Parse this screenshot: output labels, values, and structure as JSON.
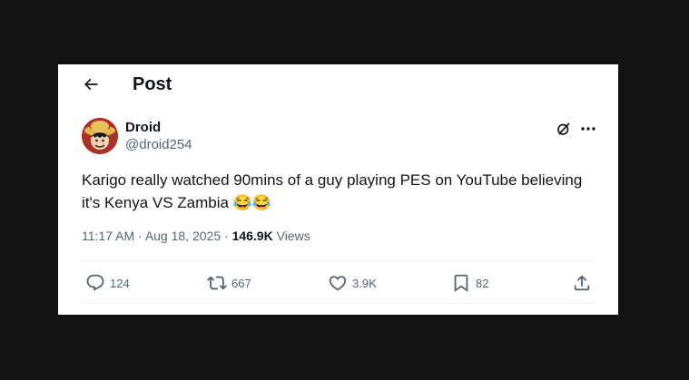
{
  "header": {
    "title": "Post",
    "back_icon": "arrow-left-icon"
  },
  "post": {
    "author_name": "Droid",
    "author_handle": "@droid254",
    "avatar_icon": "avatar-luffy-icon",
    "text": "Karigo really watched 90mins of a guy playing PES on YouTube believing it's Kenya VS Zambia 😂😂",
    "time": "11:17 AM",
    "separator": "·",
    "date": "Aug 18, 2025",
    "views_count": "146.9K",
    "views_label": "Views"
  },
  "actions": {
    "replies": "124",
    "reposts": "667",
    "likes": "3.9K",
    "bookmarks": "82"
  },
  "colors": {
    "background": "#131313",
    "card": "#ffffff",
    "text_primary": "#0f1419",
    "text_secondary": "#536471",
    "divider": "#eff3f4"
  }
}
